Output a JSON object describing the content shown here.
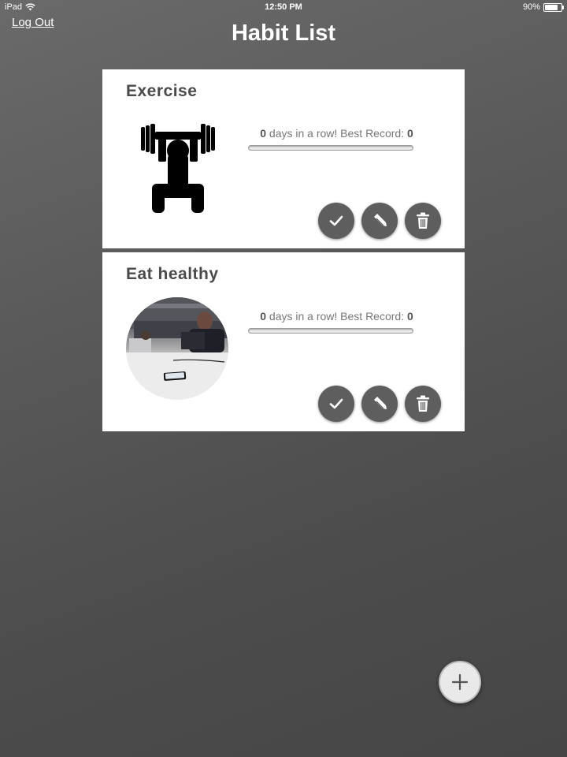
{
  "status_bar": {
    "device": "iPad",
    "time": "12:50 PM",
    "battery": "90%",
    "battery_level": 0.9
  },
  "header": {
    "logout_label": "Log Out",
    "title": "Habit List"
  },
  "habits": [
    {
      "title": "Exercise",
      "image": "weightlifting-icon",
      "streak_count": "0",
      "streak_text": " days in a row! Best Record: ",
      "best_record": "0",
      "progress": 0
    },
    {
      "title": "Eat healthy",
      "image": "habit-photo",
      "streak_count": "0",
      "streak_text": " days in a row! Best Record: ",
      "best_record": "0",
      "progress": 0
    }
  ],
  "icons": {
    "complete": "checkmark-icon",
    "edit": "pencil-icon",
    "delete": "trash-icon",
    "add": "plus-icon"
  },
  "colors": {
    "background": "#555555",
    "card": "#ffffff",
    "action_button": "#5e5e5e",
    "fab": "#e9e9e9"
  }
}
